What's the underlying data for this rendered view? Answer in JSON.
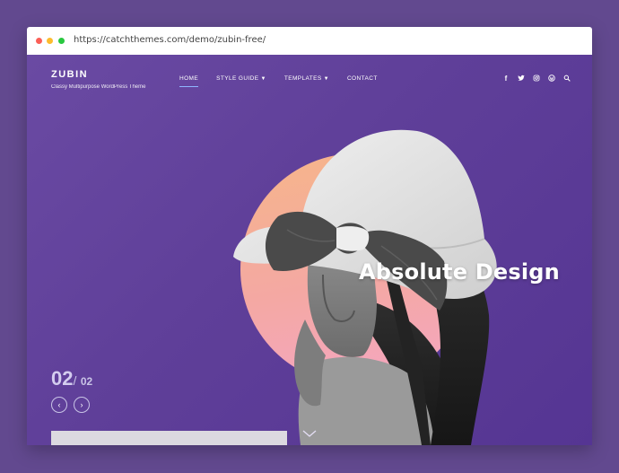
{
  "browser": {
    "url": "https://catchthemes.com/demo/zubin-free/"
  },
  "site": {
    "title": "ZUBIN",
    "tagline": "Classy Multipurpose WordPress Theme"
  },
  "nav": [
    {
      "label": "HOME",
      "active": true
    },
    {
      "label": "STYLE GUIDE",
      "dropdown": true
    },
    {
      "label": "TEMPLATES",
      "dropdown": true
    },
    {
      "label": "CONTACT"
    }
  ],
  "social": {
    "facebook": "f",
    "twitter": "🐦",
    "instagram": "◎",
    "wordpress": "Ⓦ",
    "search": "⚲"
  },
  "hero": {
    "headline": "Absolute Design",
    "slide_current": "02",
    "slide_separator": "/",
    "slide_total": "02",
    "prev_glyph": "‹",
    "next_glyph": "›"
  },
  "colors": {
    "page_bg": "#62498f",
    "hero_bg": "#5f3f99",
    "sun_gradient_top": "#f6b58a",
    "sun_gradient_bottom": "#f5a6c4",
    "nav_active_underline": "#8fb6ff"
  }
}
